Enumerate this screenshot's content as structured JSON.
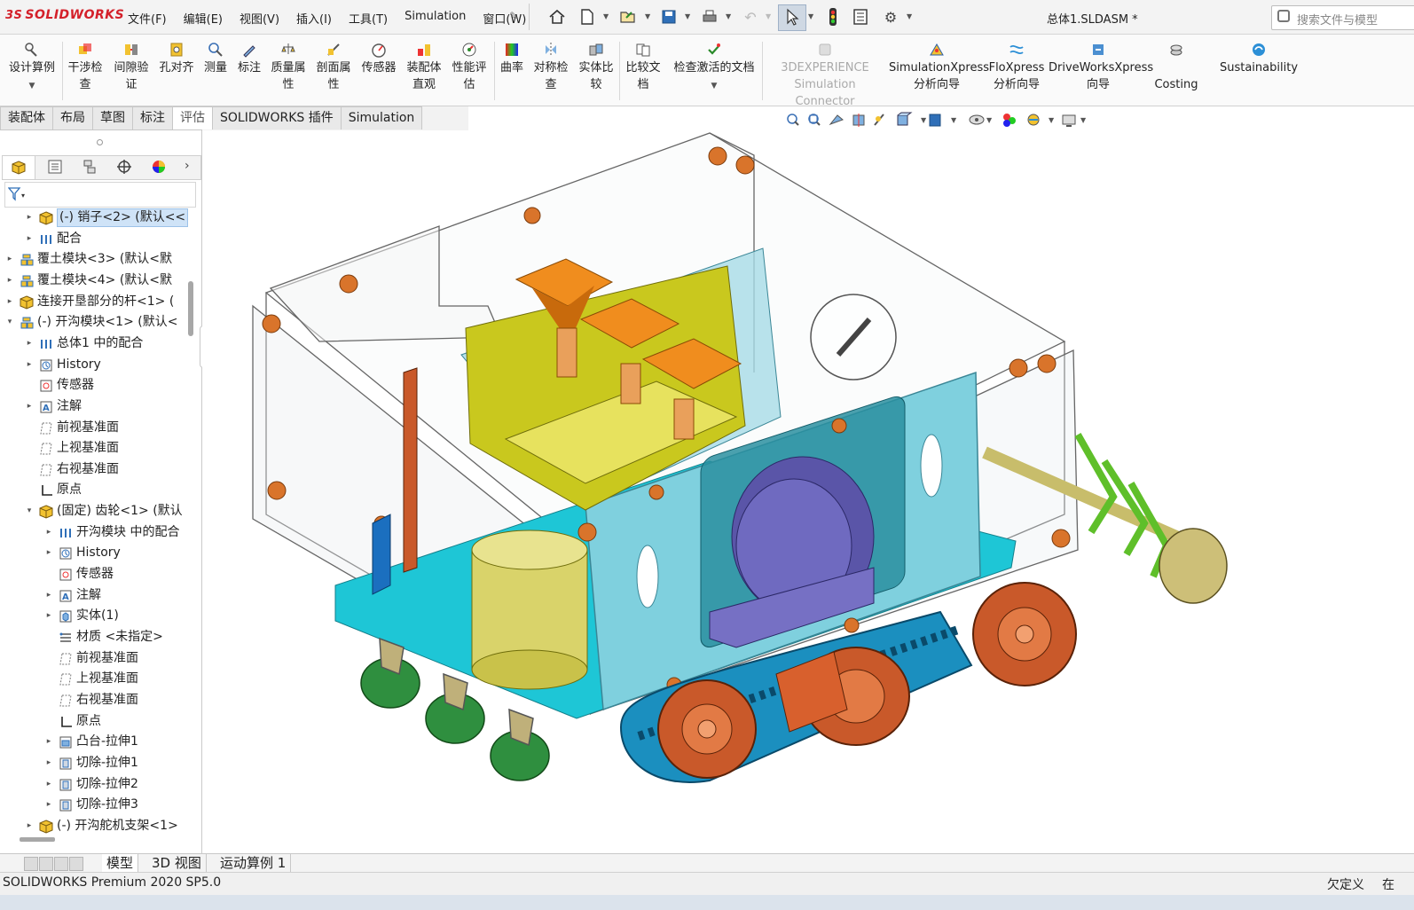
{
  "app": {
    "brand": "SOLIDWORKS",
    "brand_mark": "3S",
    "document_title": "总体1.SLDASM *",
    "search_placeholder": "搜索文件与模型"
  },
  "menu": [
    "文件(F)",
    "编辑(E)",
    "视图(V)",
    "插入(I)",
    "工具(T)",
    "Simulation",
    "窗口(W)"
  ],
  "commands": [
    {
      "label": "设计算例",
      "label2": "",
      "has_dropdown": true,
      "icon": "design-study-icon"
    },
    {
      "label": "干涉检",
      "label2": "查",
      "icon": "interference-icon"
    },
    {
      "label": "间隙验",
      "label2": "证",
      "icon": "clearance-icon"
    },
    {
      "label": "孔对齐",
      "label2": "",
      "icon": "hole-align-icon"
    },
    {
      "label": "测量",
      "label2": "",
      "icon": "measure-icon"
    },
    {
      "label": "标注",
      "label2": "",
      "icon": "markup-icon"
    },
    {
      "label": "质量属",
      "label2": "性",
      "icon": "mass-properties-icon"
    },
    {
      "label": "剖面属",
      "label2": "性",
      "icon": "section-properties-icon"
    },
    {
      "label": "传感器",
      "label2": "",
      "icon": "sensor-icon"
    },
    {
      "label": "装配体",
      "label2": "直观",
      "icon": "assembly-visualization-icon"
    },
    {
      "label": "性能评",
      "label2": "估",
      "icon": "performance-icon"
    },
    {
      "label": "曲率",
      "label2": "",
      "icon": "curvature-icon"
    },
    {
      "label": "对称检",
      "label2": "查",
      "icon": "symmetry-icon"
    },
    {
      "label": "实体比",
      "label2": "较",
      "icon": "body-compare-icon"
    },
    {
      "label": "比较文",
      "label2": "档",
      "icon": "compare-docs-icon"
    },
    {
      "label": "检查激活的文档",
      "label2": "",
      "has_dropdown": true,
      "icon": "check-doc-icon"
    },
    {
      "label": "3DEXPERIENCE",
      "label2": "Simulation Connector",
      "disabled": true,
      "icon": "3dx-icon"
    },
    {
      "label": "SimulationXpress",
      "label2": "分析向导",
      "icon": "simxpress-icon"
    },
    {
      "label": "FloXpress",
      "label2": "分析向导",
      "icon": "floxpress-icon"
    },
    {
      "label": "DriveWorksXpress",
      "label2": "向导",
      "icon": "driveworks-icon"
    },
    {
      "label": "Costing",
      "label2": "",
      "icon": "costing-icon"
    },
    {
      "label": "Sustainability",
      "label2": "",
      "icon": "sustainability-icon"
    }
  ],
  "tabs": [
    "装配体",
    "布局",
    "草图",
    "标注",
    "评估",
    "SOLIDWORKS 插件",
    "Simulation"
  ],
  "active_tab": "评估",
  "tree": [
    {
      "label": "(-) 销子<2> (默认<<",
      "level": 2,
      "expand": "▸",
      "icon": "part-icon",
      "selected": true
    },
    {
      "label": "配合",
      "level": 2,
      "expand": "▸",
      "icon": "mates-icon"
    },
    {
      "label": "覆土模块<3> (默认<默",
      "level": 1,
      "expand": "▸",
      "icon": "assembly-icon"
    },
    {
      "label": "覆土模块<4> (默认<默",
      "level": 1,
      "expand": "▸",
      "icon": "assembly-icon"
    },
    {
      "label": "连接开垦部分的杆<1> (",
      "level": 1,
      "expand": "▸",
      "icon": "part-icon"
    },
    {
      "label": "(-) 开沟模块<1> (默认<",
      "level": 1,
      "expand": "▾",
      "icon": "assembly-icon"
    },
    {
      "label": "总体1 中的配合",
      "level": 2,
      "expand": "▸",
      "icon": "mates-icon"
    },
    {
      "label": "History",
      "level": 2,
      "expand": "▸",
      "icon": "history-icon"
    },
    {
      "label": "传感器",
      "level": 2,
      "expand": "",
      "icon": "sensor-icon"
    },
    {
      "label": "注解",
      "level": 2,
      "expand": "▸",
      "icon": "annotation-icon"
    },
    {
      "label": "前视基准面",
      "level": 2,
      "expand": "",
      "icon": "plane-icon"
    },
    {
      "label": "上视基准面",
      "level": 2,
      "expand": "",
      "icon": "plane-icon"
    },
    {
      "label": "右视基准面",
      "level": 2,
      "expand": "",
      "icon": "plane-icon"
    },
    {
      "label": "原点",
      "level": 2,
      "expand": "",
      "icon": "origin-icon"
    },
    {
      "label": "(固定) 齿轮<1> (默认",
      "level": 2,
      "expand": "▾",
      "icon": "part-icon"
    },
    {
      "label": "开沟模块 中的配合",
      "level": 3,
      "expand": "▸",
      "icon": "mates-icon"
    },
    {
      "label": "History",
      "level": 3,
      "expand": "▸",
      "icon": "history-icon"
    },
    {
      "label": "传感器",
      "level": 3,
      "expand": "",
      "icon": "sensor-icon"
    },
    {
      "label": "注解",
      "level": 3,
      "expand": "▸",
      "icon": "annotation-icon"
    },
    {
      "label": "实体(1)",
      "level": 3,
      "expand": "▸",
      "icon": "solid-bodies-icon"
    },
    {
      "label": "材质 <未指定>",
      "level": 3,
      "expand": "",
      "icon": "material-icon"
    },
    {
      "label": "前视基准面",
      "level": 3,
      "expand": "",
      "icon": "plane-icon"
    },
    {
      "label": "上视基准面",
      "level": 3,
      "expand": "",
      "icon": "plane-icon"
    },
    {
      "label": "右视基准面",
      "level": 3,
      "expand": "",
      "icon": "plane-icon"
    },
    {
      "label": "原点",
      "level": 3,
      "expand": "",
      "icon": "origin-icon"
    },
    {
      "label": "凸台-拉伸1",
      "level": 3,
      "expand": "▸",
      "icon": "extrude-icon"
    },
    {
      "label": "切除-拉伸1",
      "level": 3,
      "expand": "▸",
      "icon": "cut-icon"
    },
    {
      "label": "切除-拉伸2",
      "level": 3,
      "expand": "▸",
      "icon": "cut-icon"
    },
    {
      "label": "切除-拉伸3",
      "level": 3,
      "expand": "▸",
      "icon": "cut-icon"
    },
    {
      "label": "(-) 开沟舵机支架<1>",
      "level": 2,
      "expand": "▸",
      "icon": "part-icon"
    }
  ],
  "bottom_tabs": [
    "模型",
    "3D 视图",
    "运动算例 1"
  ],
  "active_bottom_tab": "模型",
  "status": {
    "product": "SOLIDWORKS Premium 2020 SP5.0",
    "state": "欠定义",
    "extra": "在"
  },
  "colors": {
    "accent_red": "#d4202a",
    "selection": "#cfe3f7"
  }
}
